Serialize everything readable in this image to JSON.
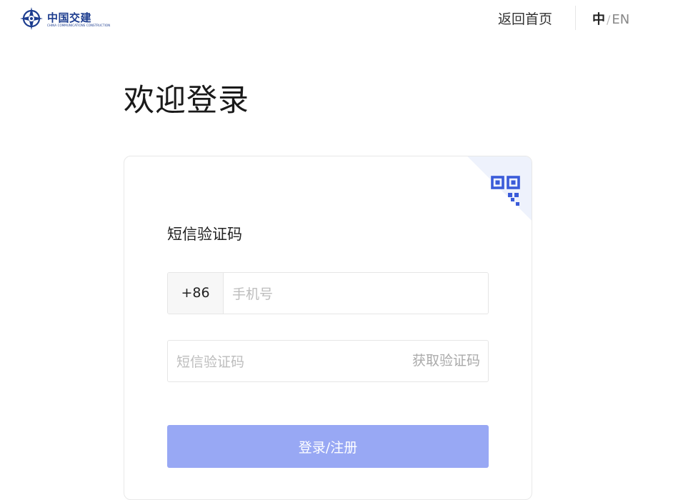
{
  "header": {
    "logo": {
      "name_cn": "中国交建",
      "name_en": "CHINA COMMUNICATIONS CONSTRUCTION"
    },
    "home_link": "返回首页",
    "language": {
      "zh": "中",
      "separator": "/",
      "en": "EN",
      "active": "zh"
    }
  },
  "page": {
    "title": "欢迎登录"
  },
  "login_card": {
    "corner_icon": "qr-code-icon",
    "title": "短信验证码",
    "phone": {
      "country_code": "+86",
      "placeholder": "手机号",
      "value": ""
    },
    "sms_code": {
      "placeholder": "短信验证码",
      "value": "",
      "get_code_label": "获取验证码"
    },
    "submit_label": "登录/注册"
  },
  "colors": {
    "brand_blue": "#1d3d8f",
    "accent_blue": "#3a5bd9",
    "button_disabled": "#98a8f4",
    "qr_corner_bg": "#eef2fc"
  }
}
